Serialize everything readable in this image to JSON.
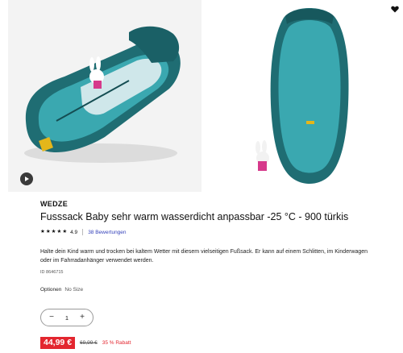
{
  "product": {
    "brand": "WEDZE",
    "title": "Fusssack Baby sehr warm wasserdicht anpassbar -25 °C - 900 türkis",
    "rating": "4.9",
    "reviews": "38 Bewertungen",
    "description": "Halte dein Kind warm und trocken bei kaltem Wetter mit diesem vielseitigen Fußsack. Er kann auf einem Schlitten, im Kinderwagen oder im Fahrradanhänger verwendet werden.",
    "id": "ID 8646715"
  },
  "options": {
    "label": "Optionen",
    "value": "No Size"
  },
  "quantity": {
    "minus": "−",
    "value": "1",
    "plus": "+"
  },
  "price": {
    "current": "44,99 €",
    "old": "69,99 €",
    "discount": "35 % Rabatt"
  },
  "gallery": {
    "images": [
      "footmuff-open-view",
      "footmuff-closed-view"
    ],
    "play_icon": "play-icon",
    "favorite_icon": "heart-icon"
  },
  "colors": {
    "accent": "#3643ba",
    "sale": "#e3262f",
    "teal": "#3aa8b0",
    "dark_teal": "#1d6a70"
  }
}
